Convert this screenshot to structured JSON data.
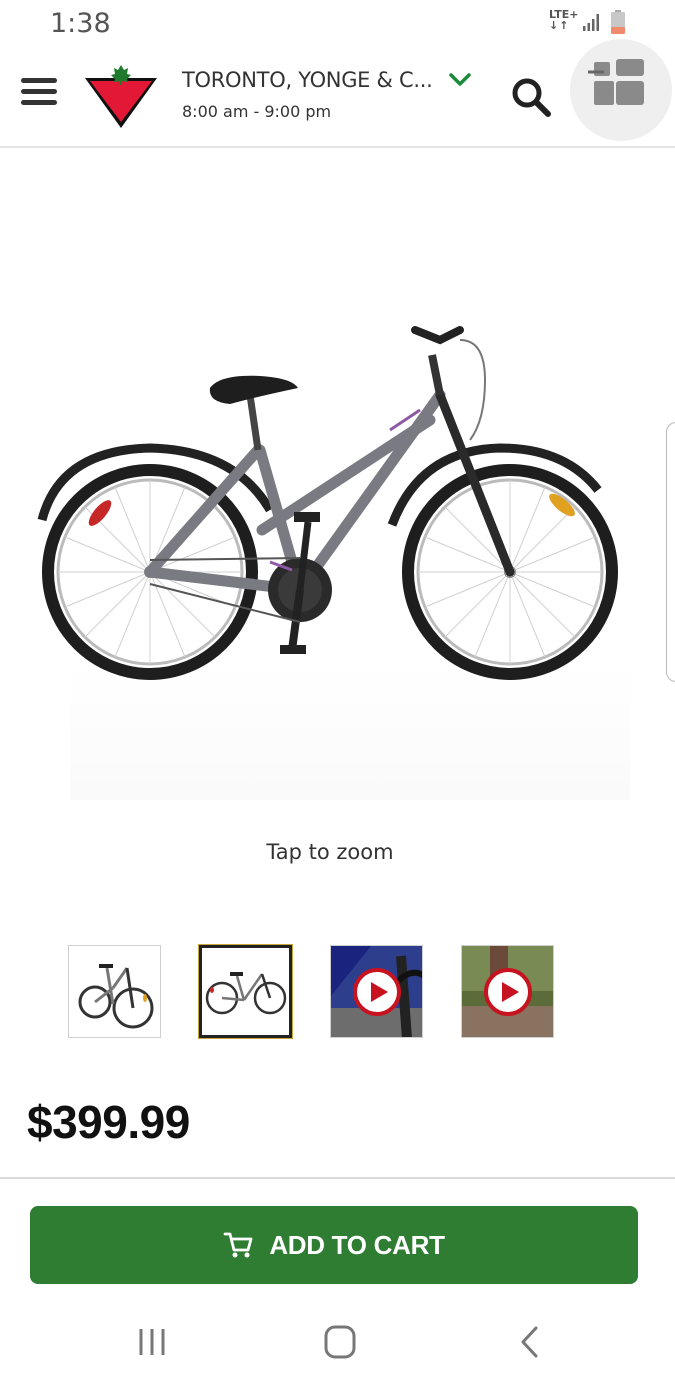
{
  "status_bar": {
    "time": "1:38",
    "network": "LTE+",
    "network_arrows": "↓↑"
  },
  "header": {
    "store_name": "TORONTO, YONGE & C...",
    "store_hours": "8:00 am - 9:00 pm",
    "icons": [
      "menu-icon",
      "canadian-tire-logo",
      "chevron-down-icon",
      "search-icon",
      "cart-icon"
    ]
  },
  "product": {
    "zoom_hint": "Tap to zoom",
    "thumbnails": [
      {
        "kind": "image"
      },
      {
        "kind": "image",
        "selected": true
      },
      {
        "kind": "video"
      },
      {
        "kind": "video"
      }
    ],
    "price": "$399.99"
  },
  "actions": {
    "add_to_cart_label": "ADD TO CART"
  },
  "colors": {
    "brand_red": "#e31837",
    "accent_green": "#2e7d32",
    "chevron_green": "#1b8a3a",
    "video_play_red": "#c7121f"
  }
}
